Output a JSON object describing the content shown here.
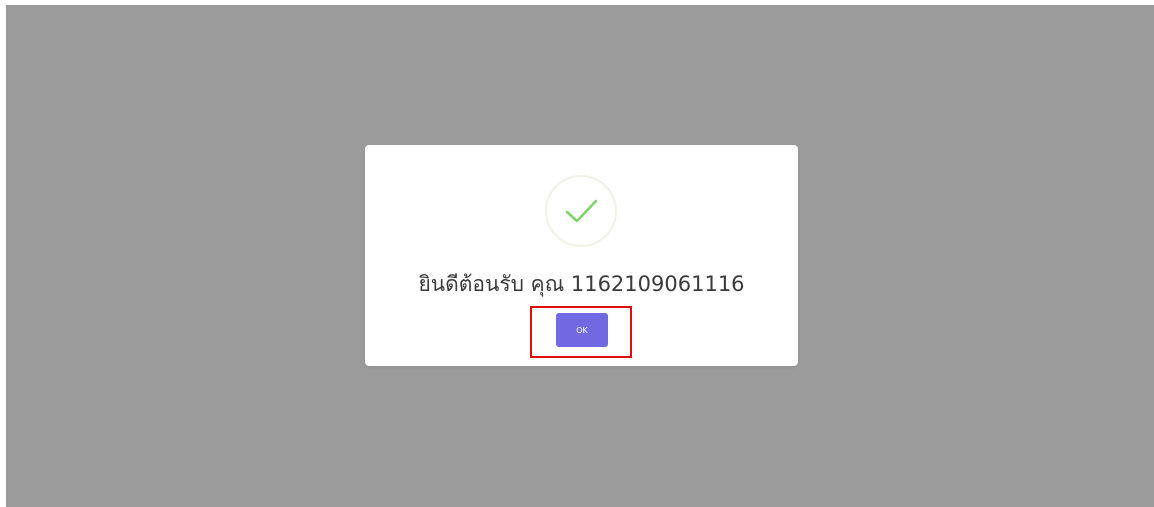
{
  "modal": {
    "icon": "checkmark-success-icon",
    "message": "ยินดีต้อนรับ คุณ 1162109061116",
    "ok_label": "OK"
  },
  "colors": {
    "backdrop": "#9b9b9b",
    "button": "#7169e2",
    "checkmark": "#7fd36b",
    "highlight": "#e10e0e"
  }
}
